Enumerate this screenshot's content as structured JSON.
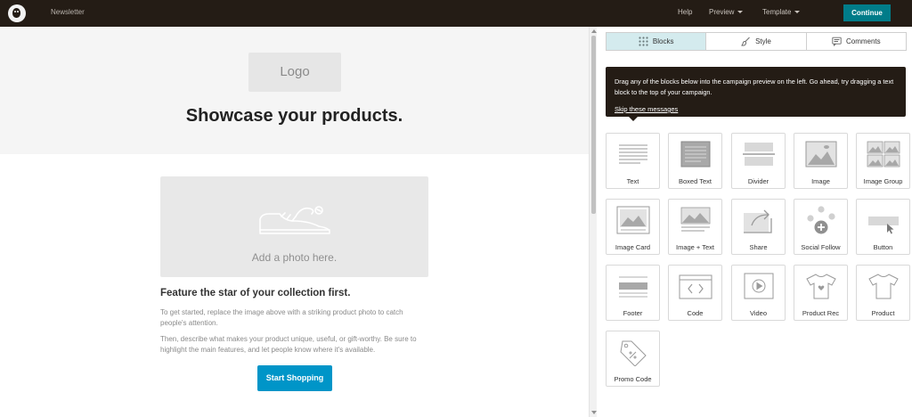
{
  "topbar": {
    "title": "Newsletter",
    "help": "Help",
    "preview": "Preview",
    "template": "Template",
    "continue": "Continue"
  },
  "preview": {
    "logo_text": "Logo",
    "headline": "Showcase your products.",
    "photo_caption": "Add a photo here.",
    "feature_title": "Feature the star of your collection first.",
    "paragraph1": "To get started, replace the image above with a striking product photo to catch people's attention.",
    "paragraph2": "Then, describe what makes your product unique, useful, or gift-worthy. Be sure to highlight the main features, and let people know where it's available.",
    "button": "Start Shopping"
  },
  "panel": {
    "tabs": [
      {
        "label": "Blocks",
        "icon": "grid-icon",
        "active": true
      },
      {
        "label": "Style",
        "icon": "paintbrush-icon",
        "active": false
      },
      {
        "label": "Comments",
        "icon": "comment-icon",
        "active": false
      }
    ],
    "tooltip": {
      "text": "Drag any of the blocks below into the campaign preview on the left. Go ahead, try dragging a text block to the top of your campaign.",
      "link": "Skip these messages"
    },
    "blocks": [
      {
        "label": "Text",
        "icon": "text-block-icon"
      },
      {
        "label": "Boxed Text",
        "icon": "boxed-text-block-icon"
      },
      {
        "label": "Divider",
        "icon": "divider-block-icon"
      },
      {
        "label": "Image",
        "icon": "image-block-icon"
      },
      {
        "label": "Image Group",
        "icon": "image-group-block-icon"
      },
      {
        "label": "Image Card",
        "icon": "image-card-block-icon"
      },
      {
        "label": "Image + Text",
        "icon": "image-text-block-icon"
      },
      {
        "label": "Share",
        "icon": "share-block-icon"
      },
      {
        "label": "Social Follow",
        "icon": "social-follow-block-icon"
      },
      {
        "label": "Button",
        "icon": "button-block-icon"
      },
      {
        "label": "Footer",
        "icon": "footer-block-icon"
      },
      {
        "label": "Code",
        "icon": "code-block-icon"
      },
      {
        "label": "Video",
        "icon": "video-block-icon"
      },
      {
        "label": "Product Rec",
        "icon": "product-rec-block-icon"
      },
      {
        "label": "Product",
        "icon": "product-block-icon"
      },
      {
        "label": "Promo Code",
        "icon": "promo-code-block-icon"
      }
    ]
  },
  "colors": {
    "topbar": "#241c15",
    "continue": "#007c89",
    "cta": "#0095c8",
    "active_tab": "#d4ebee"
  }
}
